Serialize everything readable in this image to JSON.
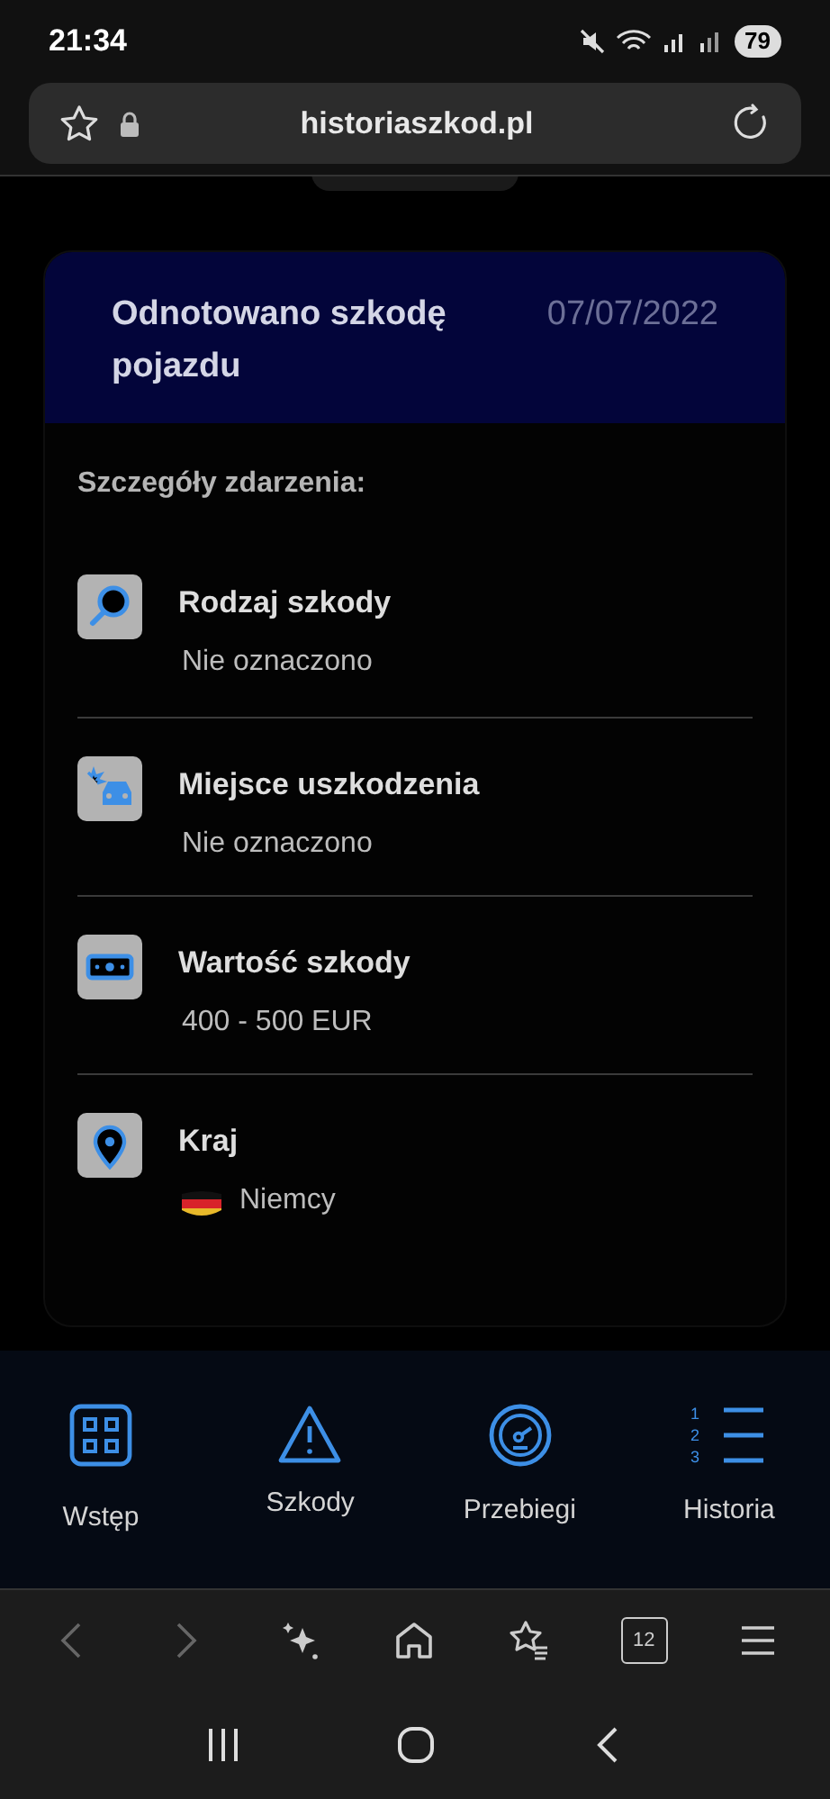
{
  "status_bar": {
    "time": "21:34",
    "battery": "79"
  },
  "address_bar": {
    "url": "historiaszkod.pl"
  },
  "card": {
    "title": "Odnotowano szkodę pojazdu",
    "date": "07/07/2022",
    "section_label": "Szczegóły zdarzenia:",
    "details": [
      {
        "kind": "search",
        "label": "Rodzaj szkody",
        "value": "Nie oznaczono"
      },
      {
        "kind": "crash",
        "label": "Miejsce uszkodzenia",
        "value": "Nie oznaczono"
      },
      {
        "kind": "money",
        "label": "Wartość szkody",
        "value": "400 - 500 EUR"
      },
      {
        "kind": "location",
        "label": "Kraj",
        "value": "Niemcy",
        "value_icon": {
          "kind": "flag"
        }
      }
    ]
  },
  "bottom_nav": [
    {
      "kind": "grid",
      "label": "Wstęp"
    },
    {
      "kind": "warning",
      "label": "Szkody"
    },
    {
      "kind": "gauge",
      "label": "Przebiegi"
    },
    {
      "kind": "list",
      "label": "Historia",
      "markers": [
        "1",
        "2",
        "3"
      ]
    }
  ],
  "browser_toolbar": {
    "tabs_count": "12"
  }
}
